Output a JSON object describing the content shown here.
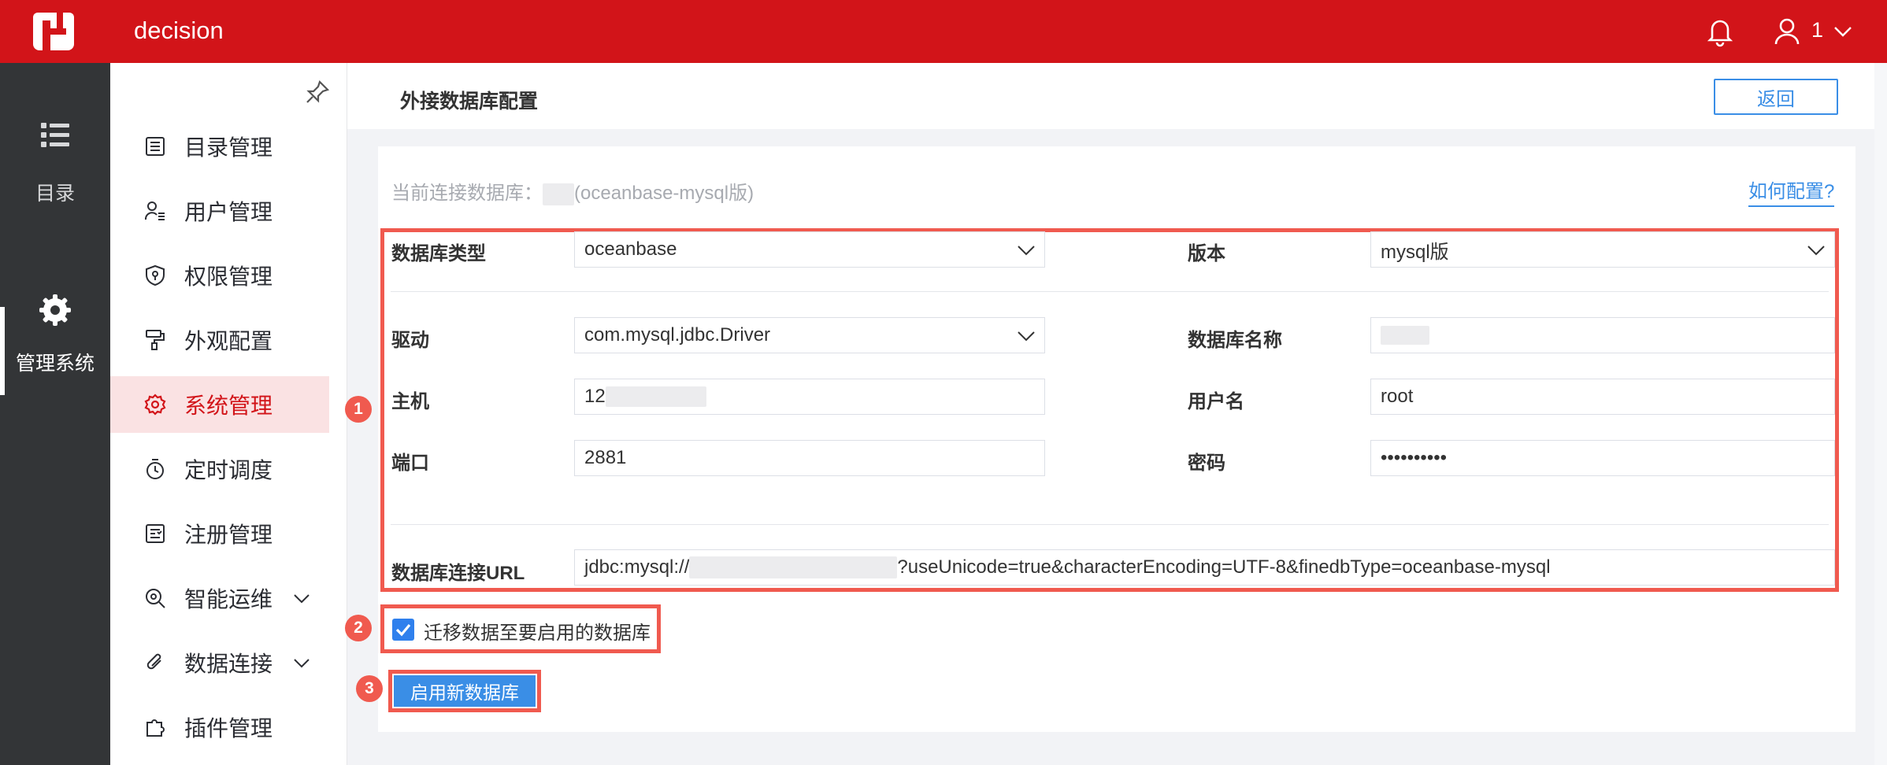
{
  "topbar": {
    "app_title": "decision",
    "user_name": "1"
  },
  "rail": {
    "items": [
      {
        "label": "目录"
      },
      {
        "label": "管理系统"
      }
    ]
  },
  "sidebar": {
    "items": [
      {
        "label": "目录管理"
      },
      {
        "label": "用户管理"
      },
      {
        "label": "权限管理"
      },
      {
        "label": "外观配置"
      },
      {
        "label": "系统管理"
      },
      {
        "label": "定时调度"
      },
      {
        "label": "注册管理"
      },
      {
        "label": "智能运维"
      },
      {
        "label": "数据连接"
      },
      {
        "label": "插件管理"
      }
    ],
    "active": "系统管理"
  },
  "page": {
    "title": "外接数据库配置",
    "back_label": "返回"
  },
  "current_db": {
    "prefix": "当前连接数据库：",
    "suffix": "(oceanbase-mysql版)"
  },
  "help_link": "如何配置?",
  "form": {
    "db_type_label": "数据库类型",
    "db_type_value": "oceanbase",
    "version_label": "版本",
    "version_value": "mysql版",
    "driver_label": "驱动",
    "driver_value": "com.mysql.jdbc.Driver",
    "db_name_label": "数据库名称",
    "db_name_value": "",
    "host_label": "主机",
    "host_value": "12",
    "username_label": "用户名",
    "username_value": "root",
    "port_label": "端口",
    "port_value": "2881",
    "password_label": "密码",
    "password_value": "••••••••••",
    "url_label": "数据库连接URL",
    "url_prefix": "jdbc:mysql://",
    "url_suffix": "?useUnicode=true&characterEncoding=UTF-8&finedbType=oceanbase-mysql"
  },
  "migrate": {
    "label": "迁移数据至要启用的数据库",
    "checked": true
  },
  "enable_button": "启用新数据库",
  "annotations": [
    "1",
    "2",
    "3"
  ],
  "colors": {
    "brand_red": "#d21419",
    "accent_blue": "#3a8ee6",
    "highlight": "#f05a4f",
    "rail_bg": "#333537"
  }
}
